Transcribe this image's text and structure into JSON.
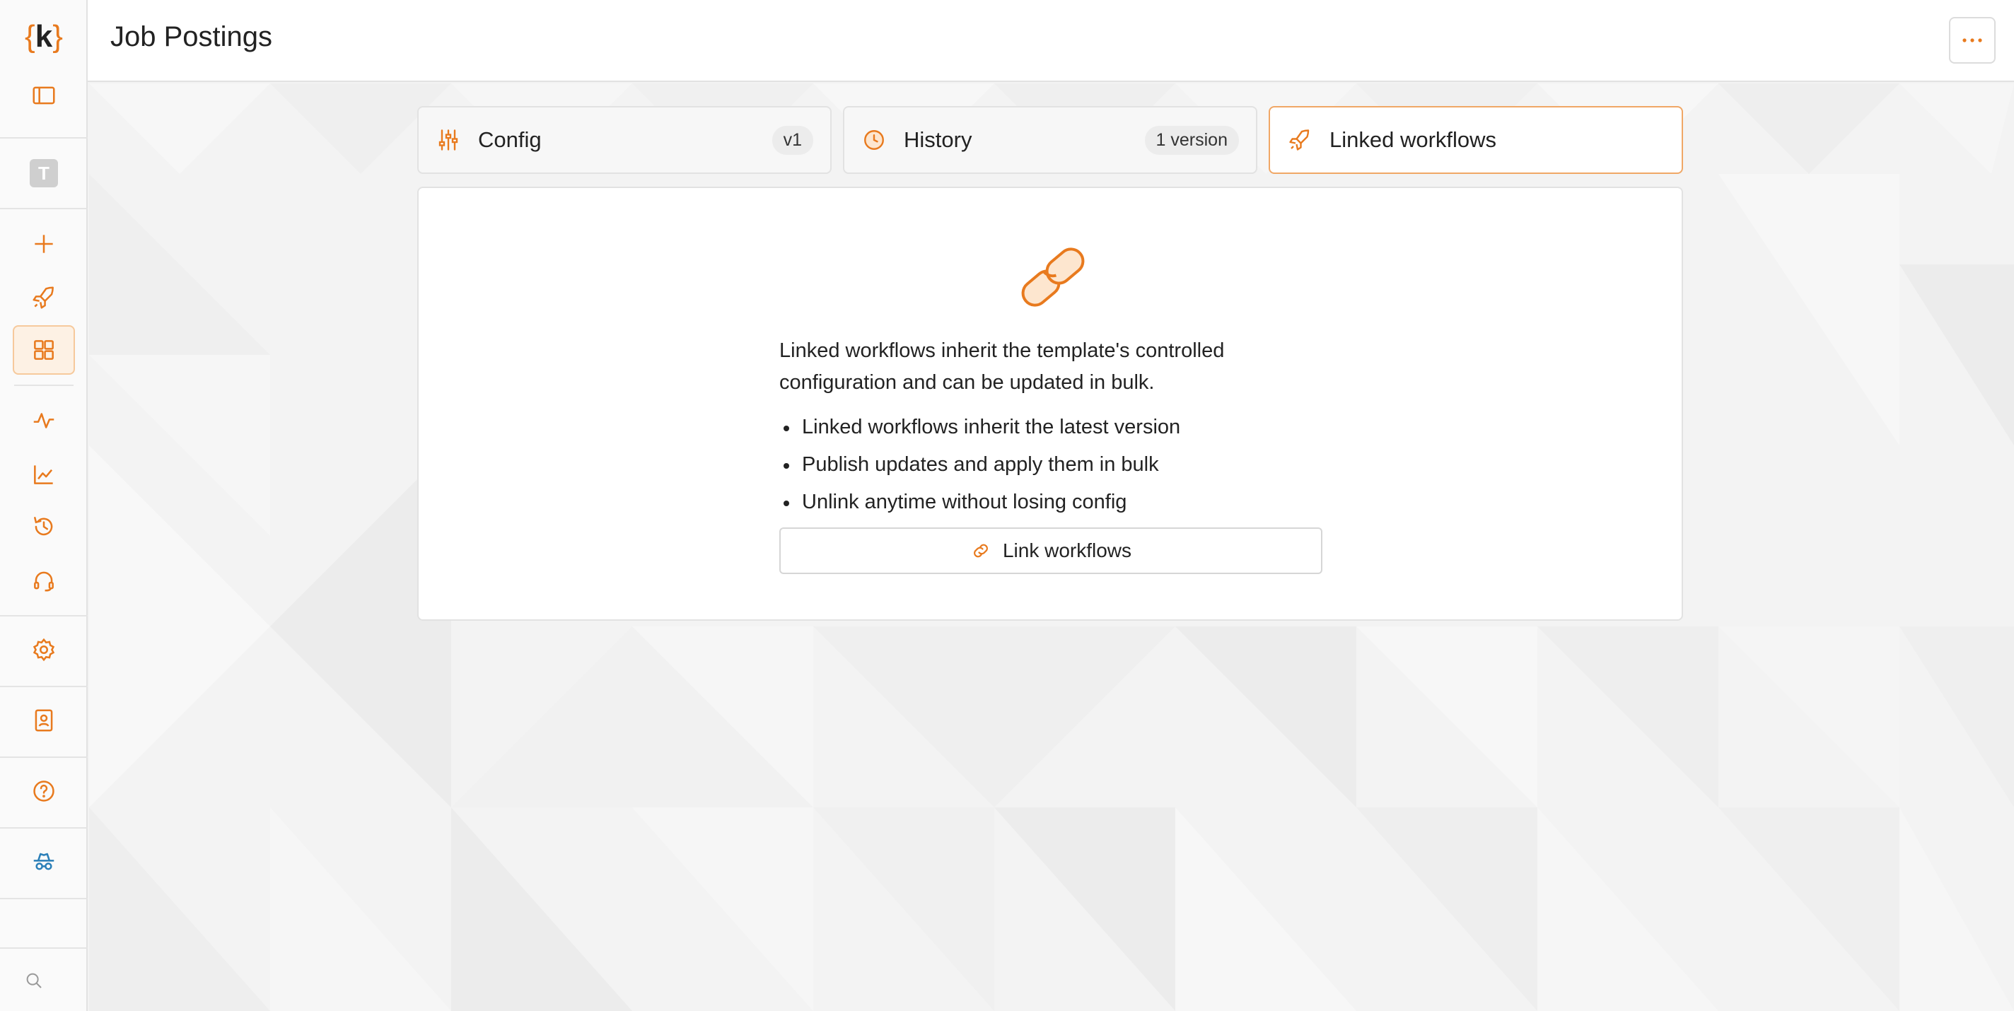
{
  "app": {
    "logo_open": "{",
    "logo_letter": "k",
    "logo_close": "}",
    "workspace_initial": "T"
  },
  "header": {
    "title": "Job Postings"
  },
  "sidebar": {
    "items": [
      {
        "icon": "panel-toggle-icon"
      },
      {
        "icon": "plus-icon"
      },
      {
        "icon": "rocket-icon"
      },
      {
        "icon": "grid-icon",
        "active": true
      },
      {
        "icon": "activity-icon"
      },
      {
        "icon": "chart-line-icon"
      },
      {
        "icon": "history-icon"
      },
      {
        "icon": "headset-icon"
      },
      {
        "icon": "gear-icon"
      },
      {
        "icon": "contact-card-icon"
      },
      {
        "icon": "help-icon"
      },
      {
        "icon": "incognito-icon"
      },
      {
        "icon": "search-icon"
      }
    ]
  },
  "tabs": [
    {
      "label": "Config",
      "badge": "v1",
      "icon": "sliders-icon"
    },
    {
      "label": "History",
      "badge": "1 version",
      "icon": "clock-icon"
    },
    {
      "label": "Linked workflows",
      "badge": "",
      "icon": "rocket-icon",
      "active": true
    }
  ],
  "panel": {
    "description": "Linked workflows inherit the template's controlled configuration and can be updated in bulk.",
    "bullets": [
      "Linked workflows inherit the latest version",
      "Publish updates and apply them in bulk",
      "Unlink anytime without losing config"
    ],
    "button_label": "Link workflows"
  },
  "colors": {
    "accent": "#e87a1e",
    "accent_light": "#fdf1e4",
    "incognito": "#2a7fb8"
  }
}
